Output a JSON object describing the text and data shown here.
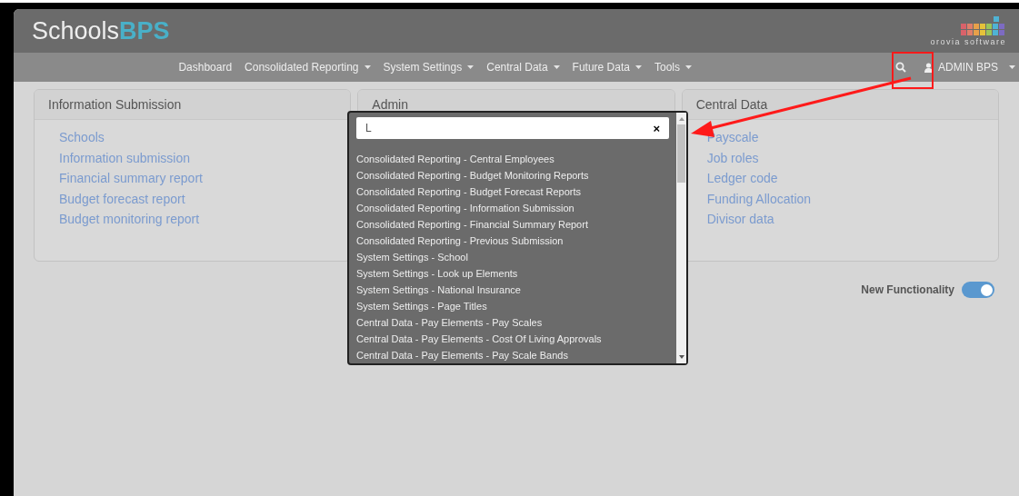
{
  "header": {
    "logo_text": "Schools",
    "logo_accent": "BPS",
    "vendor": "orovia software"
  },
  "nav": {
    "items": [
      {
        "label": "Dashboard",
        "dropdown": false
      },
      {
        "label": "Consolidated Reporting",
        "dropdown": true
      },
      {
        "label": "System Settings",
        "dropdown": true
      },
      {
        "label": "Central Data",
        "dropdown": true
      },
      {
        "label": "Future Data",
        "dropdown": true
      },
      {
        "label": "Tools",
        "dropdown": true
      }
    ],
    "user": "ADMIN BPS"
  },
  "cards": [
    {
      "title": "Information Submission",
      "links": [
        "Schools",
        "Information submission",
        "Financial summary report",
        "Budget forecast report",
        "Budget monitoring report"
      ]
    },
    {
      "title": "Admin"
    },
    {
      "title": "Central Data",
      "links": [
        "Payscale",
        "Job roles",
        "Ledger code",
        "Funding Allocation",
        "Divisor data"
      ]
    }
  ],
  "toggle": {
    "label": "New Functionality",
    "on": true
  },
  "search_popup": {
    "value": "L",
    "clear": "×",
    "results": [
      "Consolidated Reporting - Central Employees",
      "Consolidated Reporting - Budget Monitoring Reports",
      "Consolidated Reporting - Budget Forecast Reports",
      "Consolidated Reporting - Information Submission",
      "Consolidated Reporting - Financial Summary Report",
      "Consolidated Reporting - Previous Submission",
      "System Settings - School",
      "System Settings - Look up Elements",
      "System Settings - National Insurance",
      "System Settings - Page Titles",
      "Central Data - Pay Elements - Pay Scales",
      "Central Data - Pay Elements - Cost Of Living Approvals",
      "Central Data - Pay Elements - Pay Scale Bands"
    ]
  }
}
